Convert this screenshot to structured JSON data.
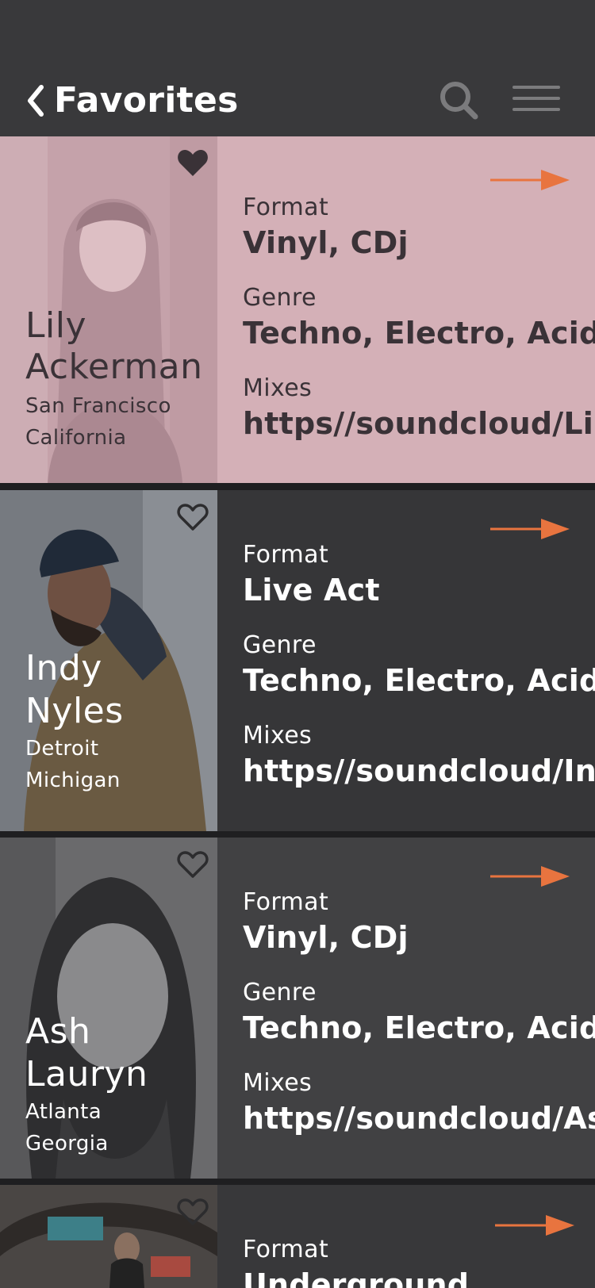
{
  "header": {
    "title": "Favorites",
    "back_icon": "chevron-left-icon",
    "search_icon": "search-icon",
    "menu_icon": "hamburger-menu-icon"
  },
  "labels": {
    "format": "Format",
    "genre": "Genre",
    "mixes": "Mixes"
  },
  "colors": {
    "background": "#39393b",
    "accent_arrow": "#e8743f",
    "card1_bg": "#d4b0b7",
    "card1_text": "#3a3237",
    "card2_bg": "#363638",
    "card3_bg": "#414143",
    "card4_bg": "#38383a"
  },
  "artists": [
    {
      "first_name": "Lily",
      "last_name": "Ackerman",
      "city": "San Francisco",
      "region": "California",
      "format": "Vinyl, CDj",
      "genre": "Techno, Electro, Acid",
      "mixes": "https//soundcloud/Lil..",
      "favorited": true
    },
    {
      "first_name": "Indy",
      "last_name": "Nyles",
      "city": "Detroit",
      "region": "Michigan",
      "format": "Live Act",
      "genre": "Techno, Electro, Acid",
      "mixes": "https//soundcloud/In..",
      "favorited": false
    },
    {
      "first_name": "Ash",
      "last_name": "Lauryn",
      "city": "Atlanta",
      "region": "Georgia",
      "format": "Vinyl, CDj",
      "genre": "Techno, Electro, Acid",
      "mixes": "https//soundcloud/As..",
      "favorited": false
    },
    {
      "format": "Underground",
      "favorited": false
    }
  ]
}
